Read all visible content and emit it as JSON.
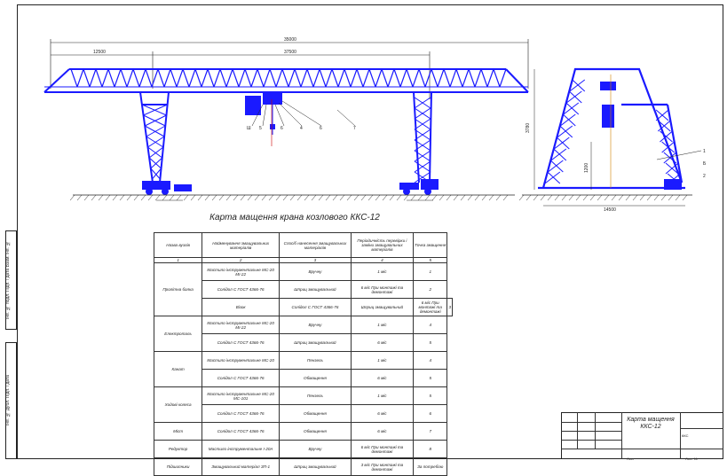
{
  "drawing": {
    "title": "Карта мащення крана козлового ККС-12",
    "dims": {
      "total_span": "35000",
      "left_cantilever": "12500",
      "main_span": "37500",
      "height": "3780",
      "lower_height": "1200",
      "base_width": "14500"
    },
    "callouts": [
      "Ш",
      "5",
      "6",
      "4",
      "6",
      "7"
    ],
    "callouts_right": [
      "1",
      "Б",
      "2"
    ]
  },
  "table": {
    "headers": [
      "Назва вузлів",
      "Найменування змащувальних матеріалів",
      "Спосіб нанесення змащувальних матеріалів",
      "Періодичність перевірки і заміни змащувальних матеріалів",
      "Точка змащення"
    ],
    "colnums": [
      "1",
      "2",
      "3",
      "4",
      "5"
    ],
    "rows": [
      {
        "unit": "Пролітна балка",
        "span": 3,
        "material": "Мастило інструментальне МС-20 МІ-22",
        "method": "Вручну",
        "period": "1 міс",
        "point": "1"
      },
      {
        "material": "Солідол С ГОСТ 4366-76",
        "method": "Шприц змащувальний",
        "period": "6 міс  При монтажі та демонтажі",
        "point": "2"
      },
      {
        "unit": "Візок",
        "span": 1,
        "material": "Солідол С ГОСТ 4366-76",
        "method": "Шприц змащувальний",
        "period": "6 міс  При монтажі та демонтажі",
        "point": "3"
      },
      {
        "unit": "Електроталь",
        "span": 2,
        "material": "Мастило інструментальне МС-20 МІ-22",
        "method": "Вручну",
        "period": "1 міс",
        "point": "4"
      },
      {
        "material": "Солідол С ГОСТ 4366-76",
        "method": "Шприц змащувальний",
        "period": "6 міс",
        "point": "5"
      },
      {
        "unit": "Канат",
        "span": 2,
        "material": "Мастило інструментальне МС-20",
        "method": "Пензель",
        "period": "1 міс",
        "point": "4"
      },
      {
        "material": "Солідол С ГОСТ 4366-76",
        "method": "Обмащення",
        "period": "6 міс",
        "point": "5"
      },
      {
        "unit": "Ходові колеса",
        "span": 2,
        "material": "Мастило інструментальне МС-20 МС-101",
        "method": "Пензель",
        "period": "1 міс",
        "point": "5"
      },
      {
        "material": "Солідол С ГОСТ 4366-76",
        "method": "Обмащення",
        "period": "6 міс",
        "point": "6"
      },
      {
        "unit": "Міст",
        "span": 1,
        "material": "Солідол С ГОСТ 4366-76",
        "method": "Обмащення",
        "period": "6 міс",
        "point": "7"
      },
      {
        "unit": "Редуктор",
        "span": 1,
        "material": "Мастило інструментальне І-20А",
        "method": "Вручну",
        "period": "6 міс  При монтажі та демонтажі",
        "point": "8"
      },
      {
        "unit": "Підшипники",
        "span": 1,
        "material": "Змащувальний матеріал ЗП-1",
        "method": "Шприц змащувальний",
        "period": "3 міс  При монтажі та демонтажі",
        "point": "За потребою"
      }
    ]
  },
  "title_block": {
    "title": "Карта мащення ККС-12",
    "sheet": "ККС",
    "bottom_left": "Лист",
    "bottom_right": "Лист 11"
  },
  "side": {
    "upper": "Інв. № подл.  Підп. і дата  Взам. інв. №",
    "lower": "Інв. № дубл.  Підп. і дата"
  }
}
